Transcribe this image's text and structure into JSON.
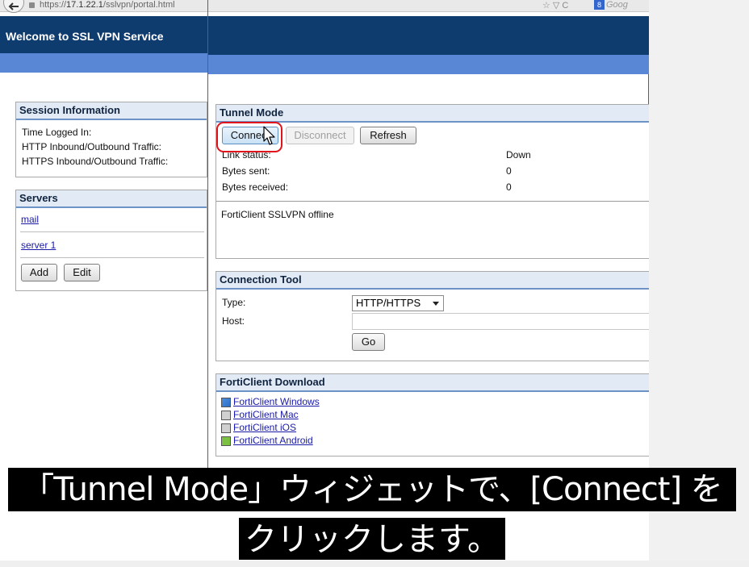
{
  "browser": {
    "url_prefix": "https://",
    "url_host": "17.1.22.1",
    "url_path": "/sslvpn/portal.html",
    "nav_icons": "☆ ▽ C",
    "search_placeholder": "Goog"
  },
  "left_header": {
    "title": "Welcome to SSL VPN Service"
  },
  "session_panel": {
    "title": "Session Information",
    "rows": [
      "Time Logged In:",
      "HTTP Inbound/Outbound Traffic:",
      "HTTPS Inbound/Outbound Traffic:"
    ]
  },
  "servers_panel": {
    "title": "Servers",
    "items": [
      "mail",
      "server 1"
    ],
    "add_label": "Add",
    "edit_label": "Edit"
  },
  "tunnel_panel": {
    "title": "Tunnel Mode",
    "connect_label": "Connect",
    "disconnect_label": "Disconnect",
    "refresh_label": "Refresh",
    "stats": [
      {
        "label": "Link status:",
        "value": "Down"
      },
      {
        "label": "Bytes sent:",
        "value": "0"
      },
      {
        "label": "Bytes received:",
        "value": "0"
      }
    ],
    "status_message": "FortiClient SSLVPN offline"
  },
  "connection_tool": {
    "title": "Connection Tool",
    "type_label": "Type:",
    "type_value": "HTTP/HTTPS",
    "host_label": "Host:",
    "host_value": "",
    "go_label": "Go"
  },
  "download_panel": {
    "title": "FortiClient Download",
    "links": [
      "FortiClient Windows",
      "FortiClient Mac",
      "FortiClient iOS",
      "FortiClient Android"
    ]
  },
  "subtitles": {
    "line1": "「Tunnel Mode」ウィジェットで、[Connect] を",
    "line2": "クリックします。"
  },
  "colors": {
    "header_dark": "#0f3c6e",
    "header_band": "#5a86d6",
    "highlight": "#e1141c",
    "link": "#1a1aa6"
  }
}
